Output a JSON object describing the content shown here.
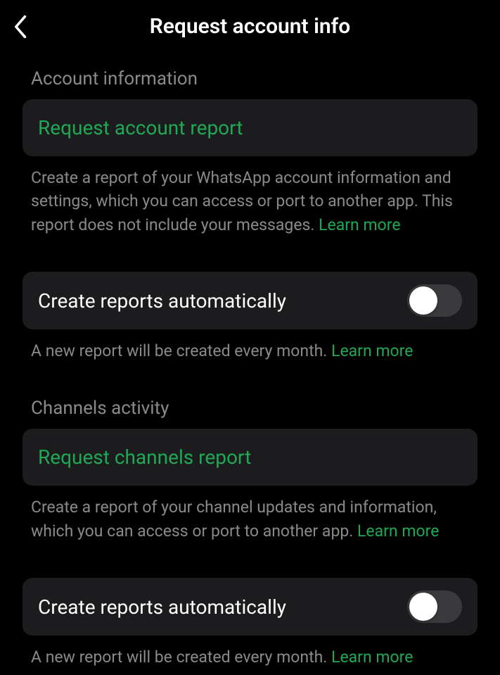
{
  "header": {
    "title": "Request account info"
  },
  "section1": {
    "heading": "Account information",
    "action_label": "Request account report",
    "description": "Create a report of your WhatsApp account information and settings, which you can access or port to another app. This report does not include your messages. ",
    "learn_more": "Learn more"
  },
  "section2": {
    "toggle_label": "Create reports automatically",
    "description": "A new report will be created every month. ",
    "learn_more": "Learn more"
  },
  "section3": {
    "heading": "Channels activity",
    "action_label": "Request channels report",
    "description": "Create a report of your channel updates and information, which you can access or port to another app. ",
    "learn_more": "Learn more"
  },
  "section4": {
    "toggle_label": "Create reports automatically",
    "description": "A new report will be created every month. ",
    "learn_more": "Learn more"
  }
}
